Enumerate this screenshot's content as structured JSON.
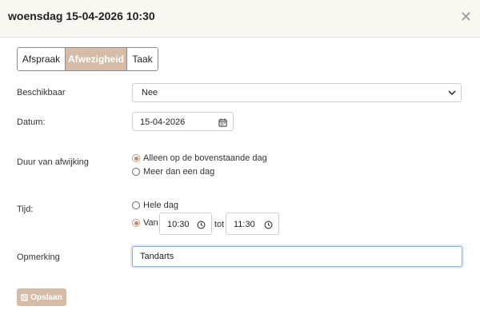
{
  "dialog": {
    "title": "woensdag 15-04-2026 10:30"
  },
  "tabs": [
    {
      "label": "Afspraak",
      "active": false
    },
    {
      "label": "Afwezigheid",
      "active": true
    },
    {
      "label": "Taak",
      "active": false
    }
  ],
  "form": {
    "beschikbaar": {
      "label": "Beschikbaar",
      "value": "Nee"
    },
    "datum": {
      "label": "Datum:",
      "value": "15-04-2026"
    },
    "duur": {
      "label": "Duur van afwijking",
      "options": [
        "Alleen op de bovenstaande dag",
        "Meer dan een dag"
      ],
      "selected": "Alleen op de bovenstaande dag"
    },
    "tijd": {
      "label": "Tijd:",
      "options": [
        "Hele dag",
        "Van"
      ],
      "selected": "Van",
      "van": "10:30",
      "tot_label": "tot",
      "tot": "11:30"
    },
    "opmerking": {
      "label": "Opmerking",
      "value": "Tandarts"
    }
  },
  "save_label": "Opslaan",
  "colors": {
    "accent": "#d6bba6",
    "radio": "#b58c70",
    "focus": "#8fb4e0"
  },
  "icons": [
    "close-icon",
    "calendar-icon",
    "clock-icon",
    "chevron-down-icon",
    "save-icon"
  ]
}
